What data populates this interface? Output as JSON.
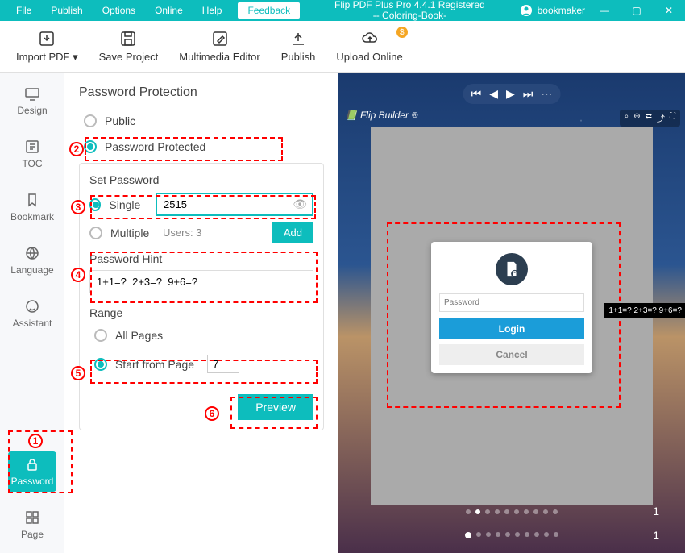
{
  "menu": {
    "file": "File",
    "publish": "Publish",
    "options": "Options",
    "online": "Online",
    "help": "Help",
    "feedback": "Feedback"
  },
  "app_title_line1": "Flip PDF Plus Pro 4.4.1 Registered",
  "app_title_line2": "-- Coloring-Book-",
  "user": "bookmaker",
  "toolbar": {
    "import": "Import PDF ▾",
    "save": "Save Project",
    "mm": "Multimedia Editor",
    "publish": "Publish",
    "upload": "Upload Online",
    "upload_badge": "$"
  },
  "sidebar": {
    "design": "Design",
    "toc": "TOC",
    "bookmark": "Bookmark",
    "language": "Language",
    "assistant": "Assistant",
    "password": "Password",
    "page": "Page"
  },
  "panel": {
    "title": "Password Protection",
    "public": "Public",
    "protected": "Password Protected",
    "setpwd": "Set Password",
    "single": "Single",
    "single_value": "2515",
    "multiple": "Multiple",
    "users_label": "Users: 3",
    "add": "Add",
    "hint_label": "Password Hint",
    "hint_value": "1+1=?  2+3=?  9+6=?",
    "range": "Range",
    "allpages": "All Pages",
    "startfrom": "Start from Page",
    "startpage": "7",
    "preview": "Preview"
  },
  "preview": {
    "brand": "Flip Builder",
    "pwd_placeholder": "Password",
    "login": "Login",
    "cancel": "Cancel",
    "tooltip": "1+1=?  2+3=?  9+6=?",
    "page_indicator": "1"
  },
  "annotations": [
    "1",
    "2",
    "3",
    "4",
    "5",
    "6"
  ]
}
